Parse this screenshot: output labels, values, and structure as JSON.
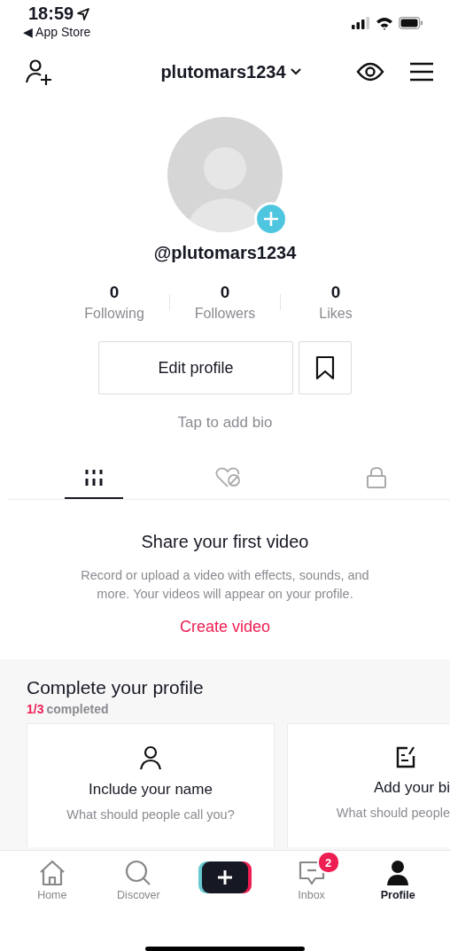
{
  "status_bar": {
    "time": "18:59",
    "back": "◀ App Store"
  },
  "header": {
    "username": "plutomars1234"
  },
  "profile": {
    "handle": "@plutomars1234",
    "stats": [
      {
        "value": "0",
        "label": "Following"
      },
      {
        "value": "0",
        "label": "Followers"
      },
      {
        "value": "0",
        "label": "Likes"
      }
    ],
    "edit_button": "Edit profile",
    "bio_placeholder": "Tap to add bio"
  },
  "tabs": [
    {
      "kind": "videos",
      "selected": true
    },
    {
      "kind": "liked",
      "selected": false
    },
    {
      "kind": "private",
      "selected": false
    }
  ],
  "empty_state": {
    "title": "Share your first video",
    "text": "Record or upload a video with effects, sounds, and more. Your videos will appear on your profile.",
    "action": "Create video"
  },
  "complete_profile": {
    "title": "Complete your profile",
    "progress": "1/3",
    "progress_label": "completed",
    "cards": [
      {
        "kind": "name",
        "title": "Include your name",
        "text": "What should people call you?"
      },
      {
        "kind": "bio",
        "title": "Add your bi",
        "text": "What should people"
      }
    ]
  },
  "bottom_nav": [
    {
      "kind": "home",
      "label": "Home",
      "selected": false
    },
    {
      "kind": "discover",
      "label": "Discover",
      "selected": false
    },
    {
      "kind": "create"
    },
    {
      "kind": "inbox",
      "label": "Inbox",
      "badge": "2",
      "selected": false
    },
    {
      "kind": "profile",
      "label": "Profile",
      "selected": true
    }
  ]
}
